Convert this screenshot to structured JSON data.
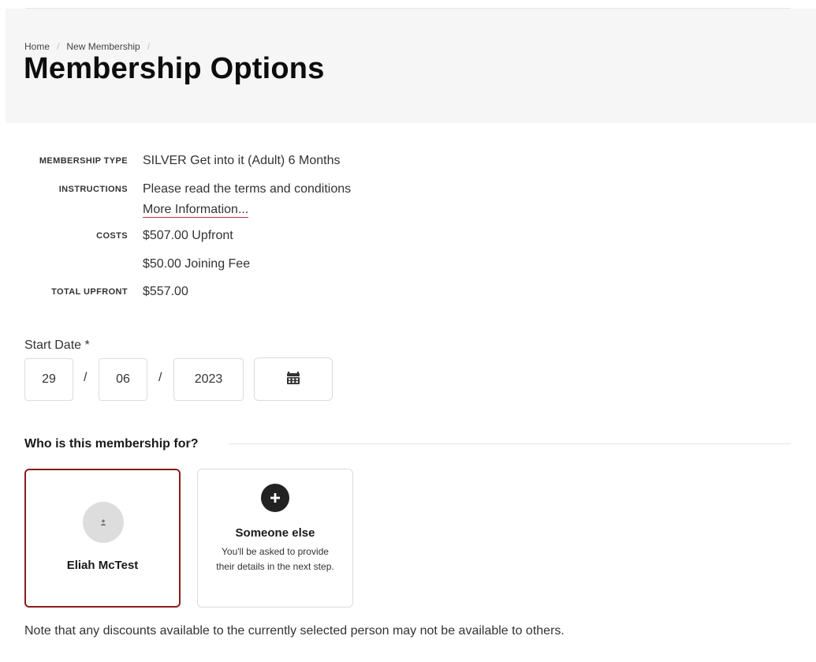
{
  "breadcrumb": {
    "home": "Home",
    "current": "New Membership",
    "separator": "/"
  },
  "page_title": "Membership Options",
  "details": {
    "membership_type_label": "MEMBERSHIP TYPE",
    "membership_type_value": "SILVER Get into it (Adult) 6 Months",
    "instructions_label": "INSTRUCTIONS",
    "instructions_value": "Please read the terms and conditions",
    "more_info_link": "More Information...",
    "costs_label": "COSTS",
    "costs_values": [
      "$507.00 Upfront",
      "$50.00 Joining Fee"
    ],
    "total_label": "TOTAL UPFRONT",
    "total_value": "$557.00"
  },
  "start_date": {
    "label": "Start Date *",
    "day": "29",
    "month": "06",
    "year": "2023",
    "separator": "/",
    "calendar_icon": "calendar-icon"
  },
  "who": {
    "title": "Who is this membership for?",
    "selected_person": {
      "name": "Eliah McTest",
      "icon": "person-icon"
    },
    "someone_else": {
      "title": "Someone else",
      "description": "You'll be asked to provide their details in the next step.",
      "icon": "plus-circle-icon"
    }
  },
  "note": "Note that any discounts available to the currently selected person may not be available to others.",
  "colors": {
    "selected_border": "#8b1c1c",
    "link_underline": "#b23a3a",
    "header_bg": "#f6f6f6"
  }
}
